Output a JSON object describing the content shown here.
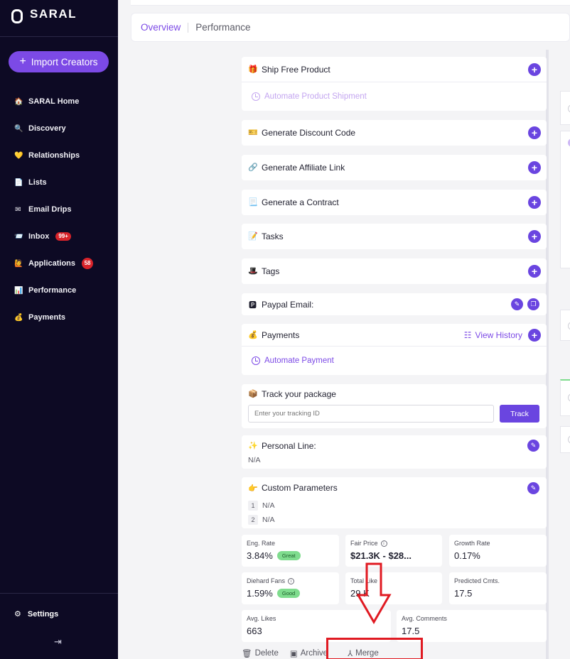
{
  "app": {
    "name": "SARAL"
  },
  "sidebar": {
    "import_label": "Import Creators",
    "items": [
      {
        "label": "SARAL Home",
        "icon": "🏠",
        "badge": ""
      },
      {
        "label": "Discovery",
        "icon": "🔍",
        "badge": ""
      },
      {
        "label": "Relationships",
        "icon": "💛",
        "badge": ""
      },
      {
        "label": "Lists",
        "icon": "📄",
        "badge": ""
      },
      {
        "label": "Email Drips",
        "icon": "✉",
        "badge": ""
      },
      {
        "label": "Inbox",
        "icon": "📨",
        "badge": "99+"
      },
      {
        "label": "Applications",
        "icon": "🙋",
        "badge": "58"
      },
      {
        "label": "Performance",
        "icon": "📊",
        "badge": ""
      },
      {
        "label": "Payments",
        "icon": "💰",
        "badge": ""
      }
    ],
    "settings_label": "Settings",
    "collapse_glyph": "⇥"
  },
  "tabs": {
    "overview": "Overview",
    "performance": "Performance"
  },
  "cards": {
    "ship": {
      "title": "Ship Free Product",
      "emoji": "🎁",
      "action": "Automate Product Shipment"
    },
    "discount": {
      "title": "Generate Discount Code",
      "emoji": "🎫"
    },
    "affiliate": {
      "title": "Generate Affiliate Link",
      "emoji": "🔗"
    },
    "contract": {
      "title": "Generate a Contract",
      "emoji": "📃"
    },
    "tasks": {
      "title": "Tasks",
      "emoji": "📝"
    },
    "tags": {
      "title": "Tags",
      "emoji": "🎩"
    },
    "paypal": {
      "title": "Paypal Email:",
      "emoji": "🅿"
    },
    "payments": {
      "title": "Payments",
      "emoji": "💰",
      "history": "View History",
      "action": "Automate Payment"
    },
    "track": {
      "title": "Track your package",
      "emoji": "📦",
      "placeholder": "Enter your tracking ID",
      "button": "Track"
    },
    "personal": {
      "title": "Personal Line:",
      "emoji": "✨",
      "value": "N/A"
    },
    "custom": {
      "title": "Custom Parameters",
      "emoji": "👉",
      "params": [
        {
          "idx": "1",
          "value": "N/A"
        },
        {
          "idx": "2",
          "value": "N/A"
        }
      ]
    }
  },
  "stats": {
    "eng_rate": {
      "label": "Eng. Rate",
      "value": "3.84%",
      "pill": "Great"
    },
    "fair_price": {
      "label": "Fair Price",
      "value": "$21.3K - $28..."
    },
    "growth_rate": {
      "label": "Growth Rate",
      "value": "0.17%"
    },
    "diehard": {
      "label": "Diehard Fans",
      "value": "1.59%",
      "pill": "Good"
    },
    "total_likes": {
      "label": "Total Like",
      "value": "29 K"
    },
    "pred_cmts": {
      "label": "Predicted Cmts.",
      "value": "17.5"
    },
    "avg_likes": {
      "label": "Avg. Likes",
      "value": "663"
    },
    "avg_comments": {
      "label": "Avg. Comments",
      "value": "17.5"
    }
  },
  "actions": {
    "delete": "Delete",
    "archive": "Archive",
    "merge": "Merge"
  },
  "colors": {
    "accent": "#7c4ae6",
    "sidebar": "#0d0a24",
    "badge": "#d8232a",
    "annotation": "#e01a22"
  }
}
